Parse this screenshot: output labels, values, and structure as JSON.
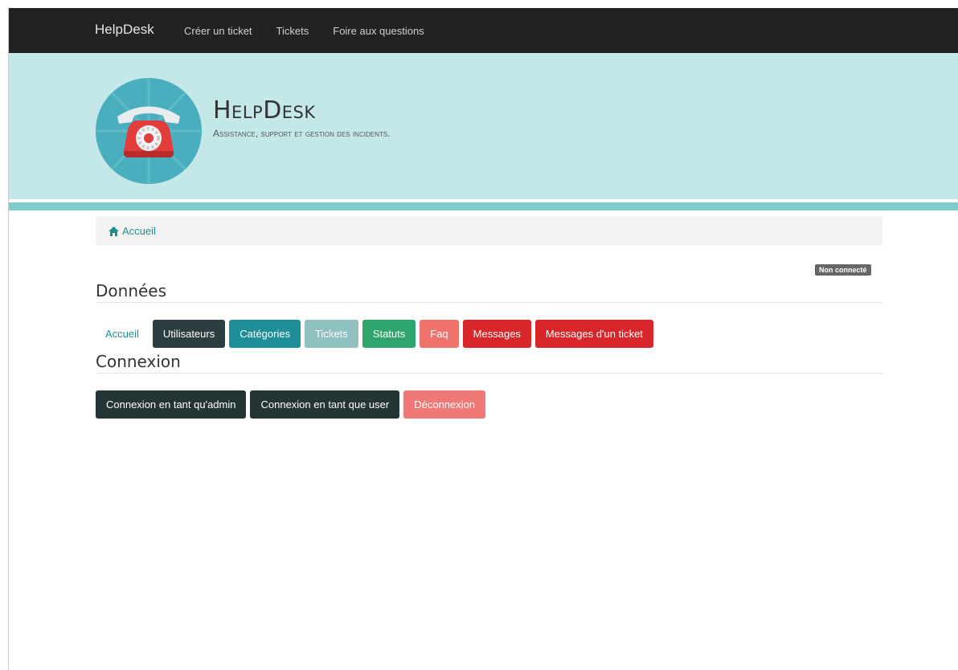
{
  "navbar": {
    "brand": "HelpDesk",
    "links": [
      "Créer un ticket",
      "Tickets",
      "Foire aux questions"
    ]
  },
  "hero": {
    "title": "HelpDesk",
    "subtitle": "Assistance, support et gestion des incidents."
  },
  "breadcrumb": {
    "home_label": "Accueil"
  },
  "status": {
    "label": "Non connecté"
  },
  "data_section": {
    "title": "Données",
    "buttons": [
      {
        "label": "Accueil",
        "color": "transparent"
      },
      {
        "label": "Utilisateurs",
        "color": "#2c3e3f"
      },
      {
        "label": "Catégories",
        "color": "#1e8f99"
      },
      {
        "label": "Tickets",
        "color": "#8fc1c1"
      },
      {
        "label": "Statuts",
        "color": "#2fa56d"
      },
      {
        "label": "Faq",
        "color": "#f0726d"
      },
      {
        "label": "Messages",
        "color": "#d9262b"
      },
      {
        "label": "Messages d'un ticket",
        "color": "#d9262b"
      }
    ]
  },
  "connexion_section": {
    "title": "Connexion",
    "buttons": [
      {
        "label": "Connexion en tant qu'admin",
        "color": "#243535"
      },
      {
        "label": "Connexion en tant que user",
        "color": "#243535"
      },
      {
        "label": "Déconnexion",
        "color": "#f07876"
      }
    ]
  },
  "icons": {
    "home": "home-icon",
    "logo": "telephone-logo-icon"
  }
}
